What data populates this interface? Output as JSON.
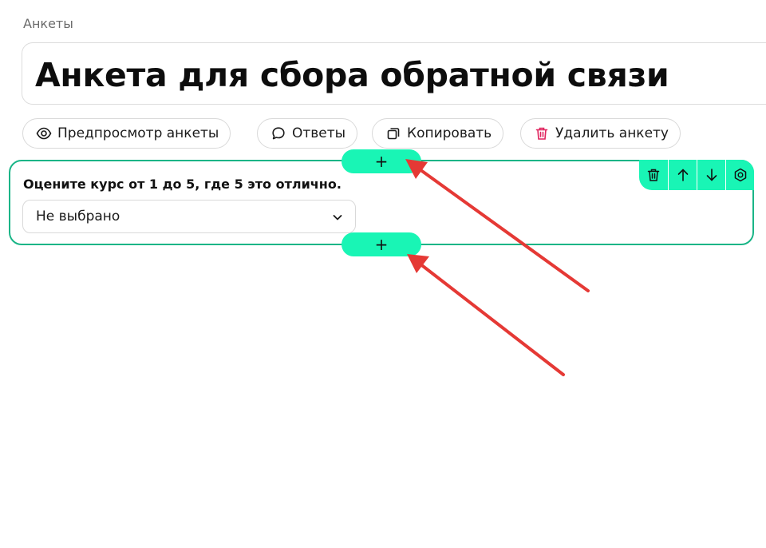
{
  "breadcrumb": "Анкеты",
  "form": {
    "title": "Анкета для сбора обратной связи"
  },
  "toolbar": {
    "preview_label": "Предпросмотр анкеты",
    "answers_label": "Ответы",
    "copy_label": "Копировать",
    "delete_label": "Удалить анкету"
  },
  "question": {
    "text": "Оцените курс от 1 до 5, где 5 это отлично.",
    "selected_value": "Не выбрано"
  },
  "add_button": {
    "label": "+"
  },
  "colors": {
    "accent": "#19f5b5",
    "card_border": "#1ab587",
    "delete_icon": "#e0245e",
    "annotation_arrow": "#e53935"
  },
  "icons": {
    "preview": "eye-icon",
    "answers": "speech-bubble-icon",
    "copy": "copy-icon",
    "delete": "trash-icon",
    "move_up": "arrow-up-icon",
    "move_down": "arrow-down-icon",
    "settings": "gear-icon",
    "dropdown": "chevron-down-icon"
  }
}
